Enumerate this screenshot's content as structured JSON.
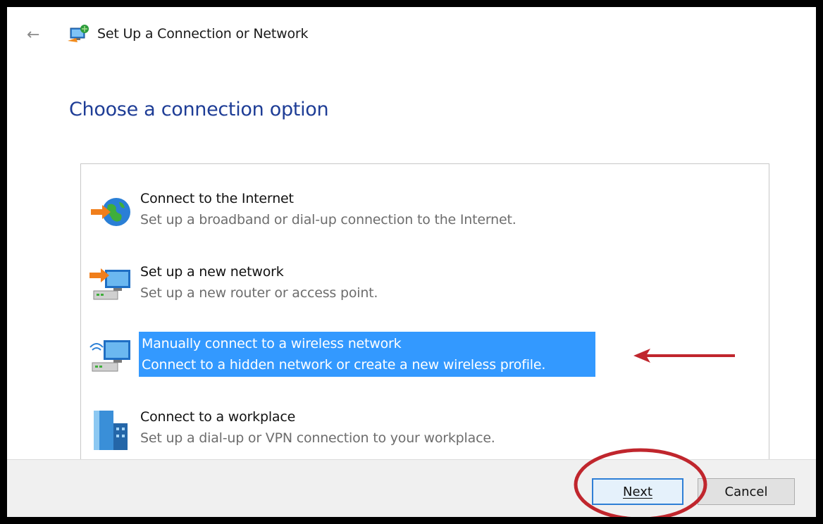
{
  "window": {
    "title": "Set Up a Connection or Network",
    "back_icon": "back-arrow-icon",
    "title_icon": "network-setup-icon"
  },
  "page": {
    "heading": "Choose a connection option"
  },
  "options": [
    {
      "title": "Connect to the Internet",
      "description": "Set up a broadband or dial-up connection to the Internet.",
      "icon": "globe-internet-icon",
      "selected": false
    },
    {
      "title": "Set up a new network",
      "description": "Set up a new router or access point.",
      "icon": "new-network-icon",
      "selected": false
    },
    {
      "title": "Manually connect to a wireless network",
      "description": "Connect to a hidden network or create a new wireless profile.",
      "icon": "wireless-network-icon",
      "selected": true
    },
    {
      "title": "Connect to a workplace",
      "description": "Set up a dial-up or VPN connection to your workplace.",
      "icon": "workplace-building-icon",
      "selected": false
    }
  ],
  "footer": {
    "next_label": "Next",
    "cancel_label": "Cancel"
  },
  "colors": {
    "heading": "#1e3d96",
    "selection": "#3399ff",
    "annotation": "#c0262d"
  }
}
